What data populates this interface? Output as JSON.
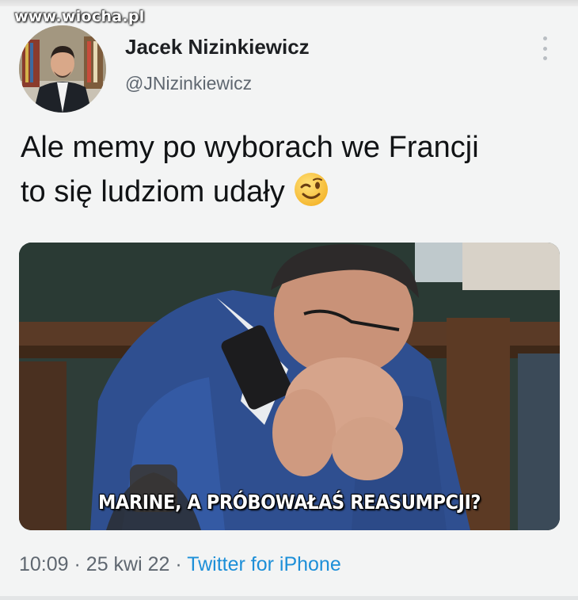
{
  "watermark": "www.wiocha.pl",
  "tweet": {
    "author_name": "Jacek Nizinkiewicz",
    "author_handle": "@JNizinkiewicz",
    "text_lines": [
      "Ale memy po wyborach we Francji",
      "to się ludziom udały"
    ],
    "emoji": "wink-face",
    "media": {
      "caption": "MARINE, A PRÓBOWAŁAŚ REASUMPCJI?"
    },
    "time": "10:09",
    "separator": "·",
    "date": "25 kwi 22",
    "source": "Twitter for iPhone"
  },
  "icons": {
    "more": "more-vertical-icon",
    "emoji": "winking-face-icon"
  },
  "colors": {
    "background": "#f3f4f4",
    "name_text": "#1d1f22",
    "secondary_text": "#5f6770",
    "link": "#1d8fd8"
  }
}
